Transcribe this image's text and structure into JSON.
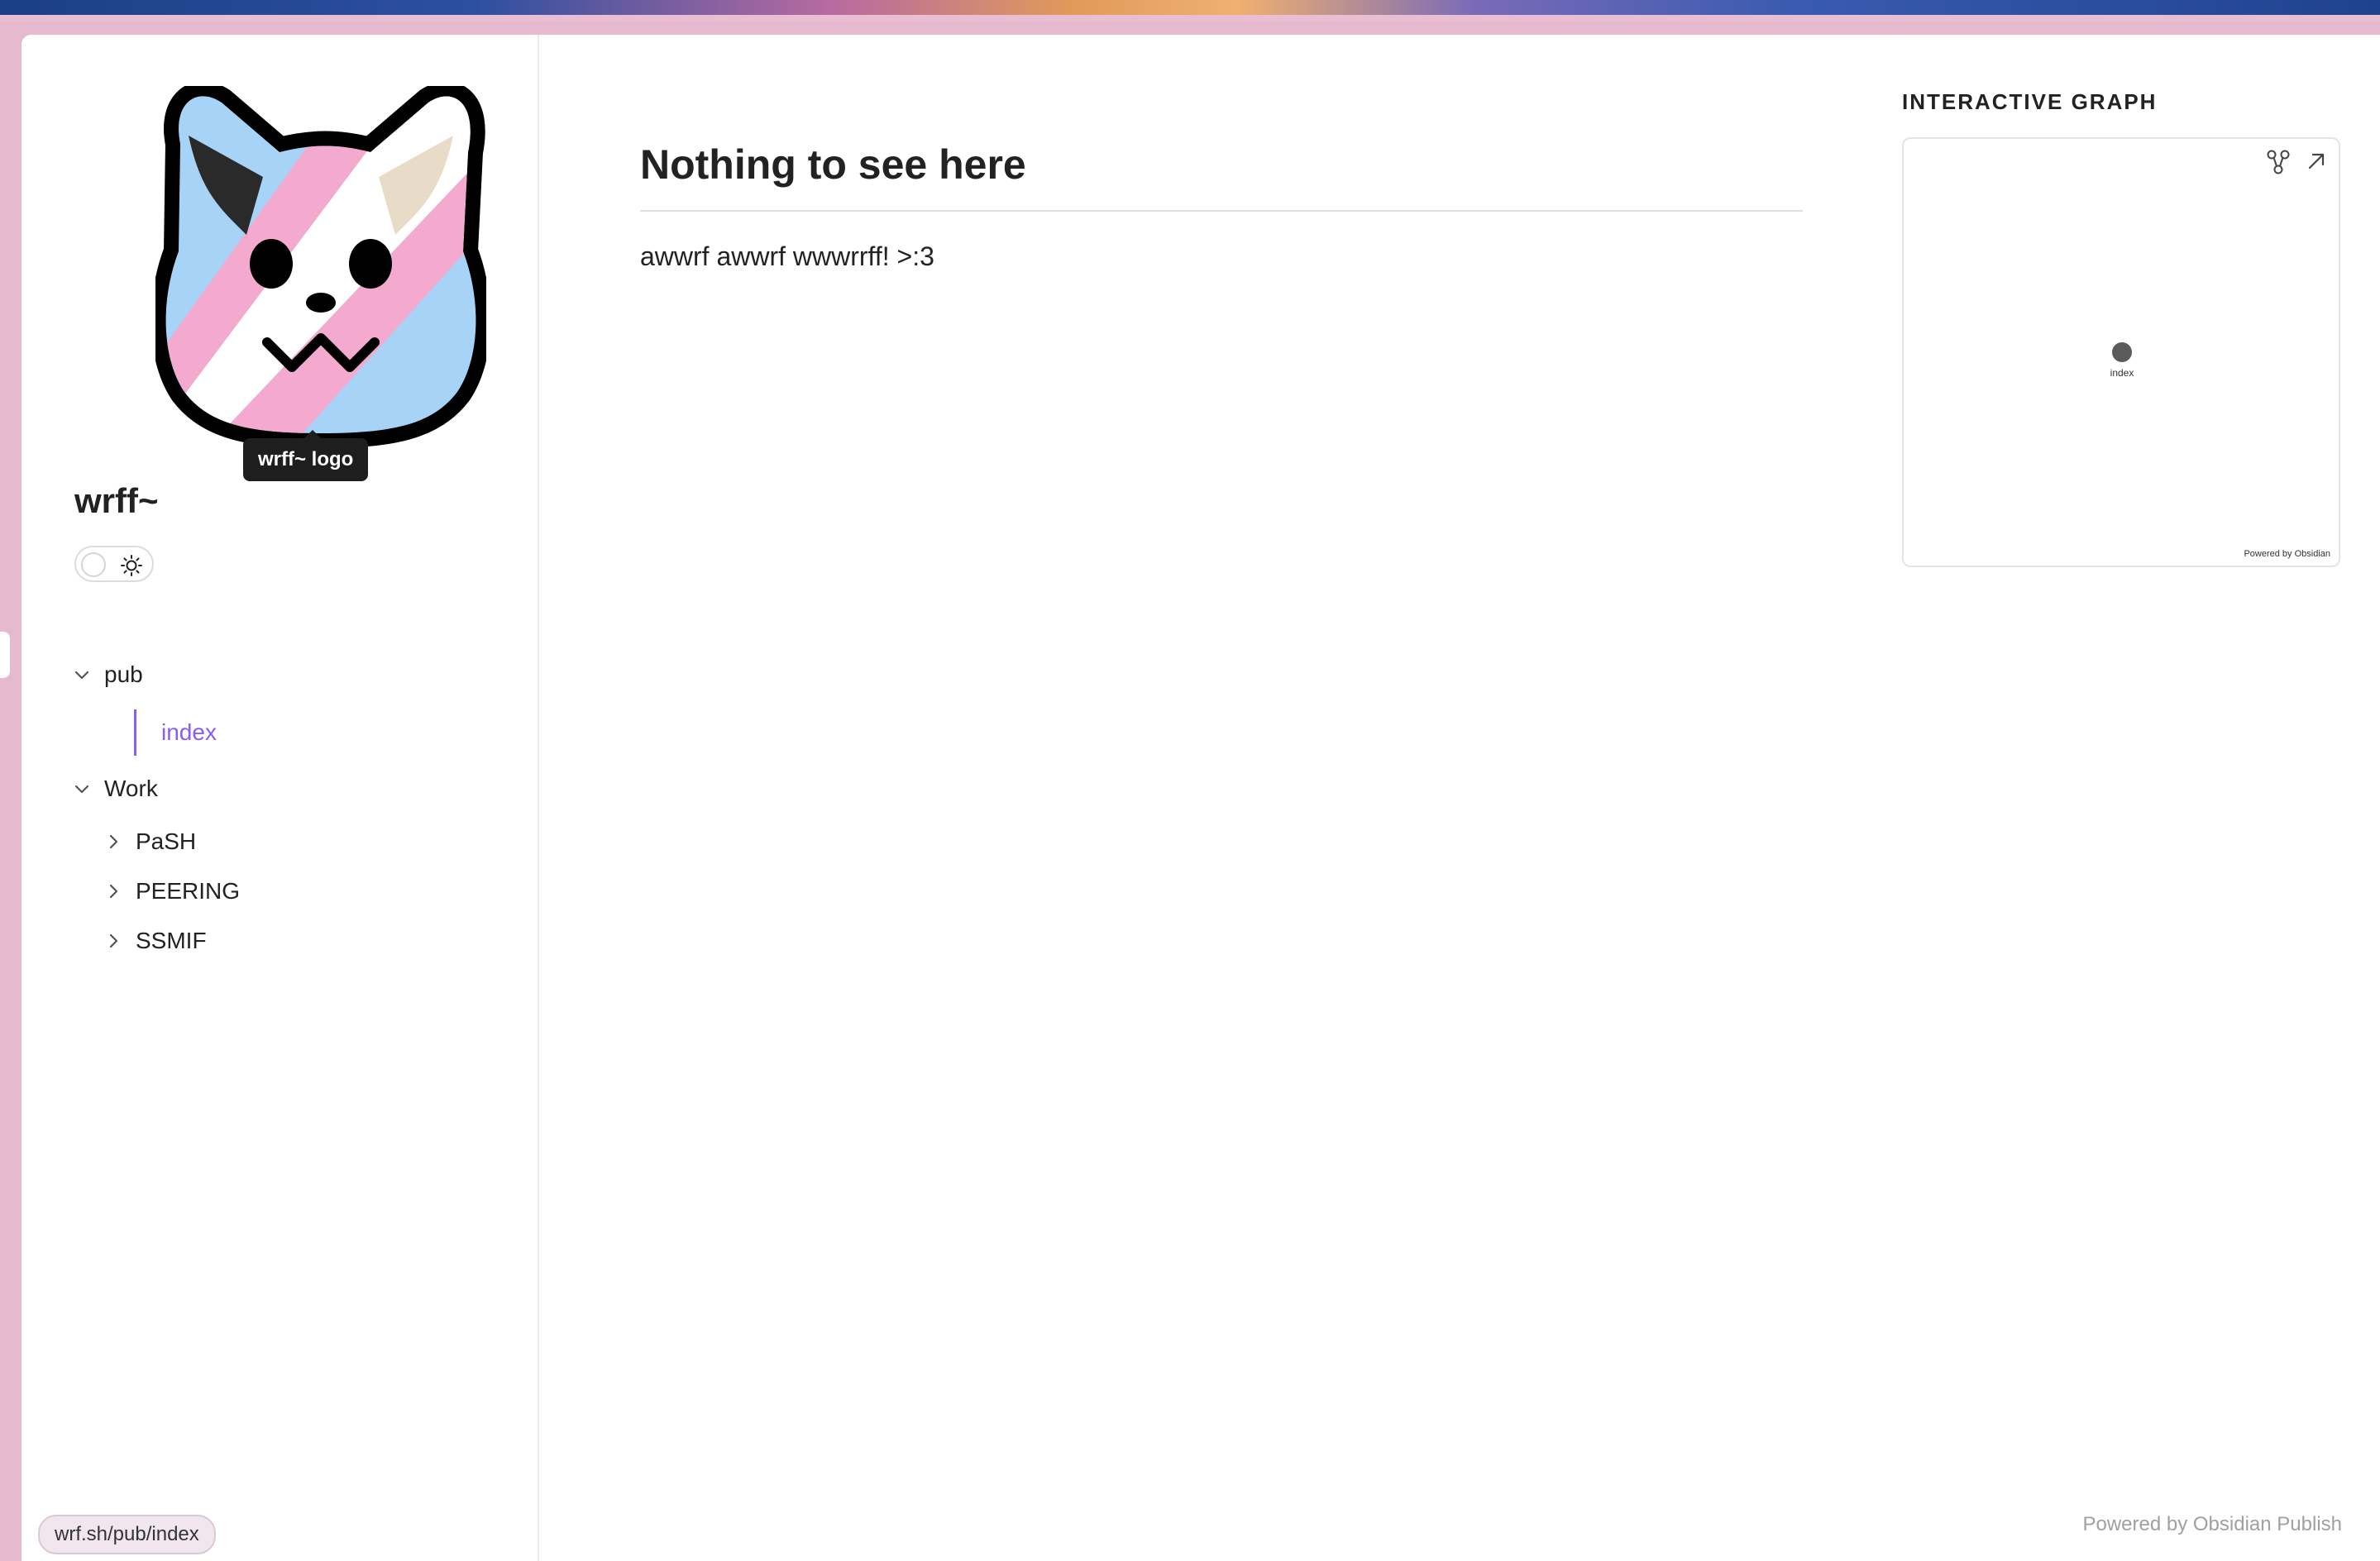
{
  "site": {
    "name": "wrff~",
    "logo_tooltip": "wrff~ logo"
  },
  "nav": {
    "folders": [
      {
        "label": "pub",
        "expanded": true,
        "files": [
          {
            "label": "index",
            "active": true
          }
        ]
      },
      {
        "label": "Work",
        "expanded": true,
        "subfolders": [
          {
            "label": "PaSH",
            "expanded": false
          },
          {
            "label": "PEERING",
            "expanded": false
          },
          {
            "label": "SSMIF",
            "expanded": false
          }
        ]
      }
    ]
  },
  "page": {
    "title": "Nothing to see here",
    "body": "awwrf awwrf wwwrrff! >:3"
  },
  "graph": {
    "heading": "INTERACTIVE GRAPH",
    "node_label": "index",
    "footer": "Powered by Obsidian"
  },
  "footer": {
    "publish": "Powered by Obsidian Publish"
  },
  "status": {
    "url": "wrf.sh/pub/index"
  },
  "colors": {
    "accent": "#8a5cf5",
    "trans_blue": "#a7d3f7",
    "trans_pink": "#f4a9cf",
    "trans_white": "#ffffff"
  },
  "icons": [
    "sun-icon",
    "chevron-down-icon",
    "chevron-right-icon",
    "graph-settings-icon",
    "expand-arrow-icon"
  ]
}
